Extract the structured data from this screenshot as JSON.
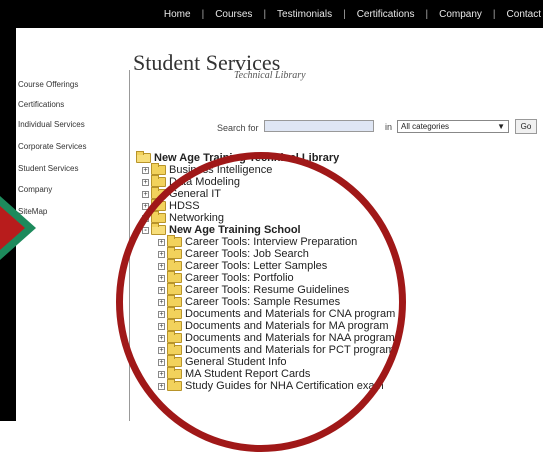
{
  "navbar": {
    "items": [
      "Home",
      "Courses",
      "Testimonials",
      "Certifications",
      "Company",
      "Contact"
    ],
    "separator": "|"
  },
  "sidebar": {
    "items": [
      "Course Offerings",
      "Certifications",
      "Individual Services",
      "Corporate Services",
      "Student Services",
      "Company",
      "SiteMap"
    ]
  },
  "page": {
    "title": "Student Services",
    "subtitle": "Technical Library"
  },
  "search": {
    "label": "Search for",
    "value": "",
    "in_label": "in",
    "category_selected": "All categories",
    "go_label": "Go"
  },
  "tree": {
    "root": "New Age Training Technical Library",
    "items": [
      {
        "label": "Business Intelligence",
        "expander": "+"
      },
      {
        "label": "Data Modeling",
        "expander": "+"
      },
      {
        "label": "General IT",
        "expander": "+"
      },
      {
        "label": "HDSS",
        "expander": "+"
      },
      {
        "label": "Networking",
        "expander": "+"
      },
      {
        "label": "New Age Training School",
        "expander": "-"
      }
    ],
    "school_children": [
      "Career Tools: Interview Preparation",
      "Career Tools: Job Search",
      "Career Tools: Letter Samples",
      "Career Tools: Portfolio",
      "Career Tools: Resume Guidelines",
      "Career Tools: Sample Resumes",
      "Documents and Materials for CNA program",
      "Documents and Materials for MA program",
      "Documents and Materials for NAA program",
      "Documents and Materials for PCT program",
      "General Student Info",
      "MA Student Report Cards",
      "Study Guides for NHA Certification exam"
    ]
  },
  "colors": {
    "navbar_bg": "#000000",
    "highlight_oval": "#a01818",
    "arrow_outer": "#1d8a5c",
    "arrow_inner": "#b81c1c",
    "folder": "#f2d25c"
  }
}
